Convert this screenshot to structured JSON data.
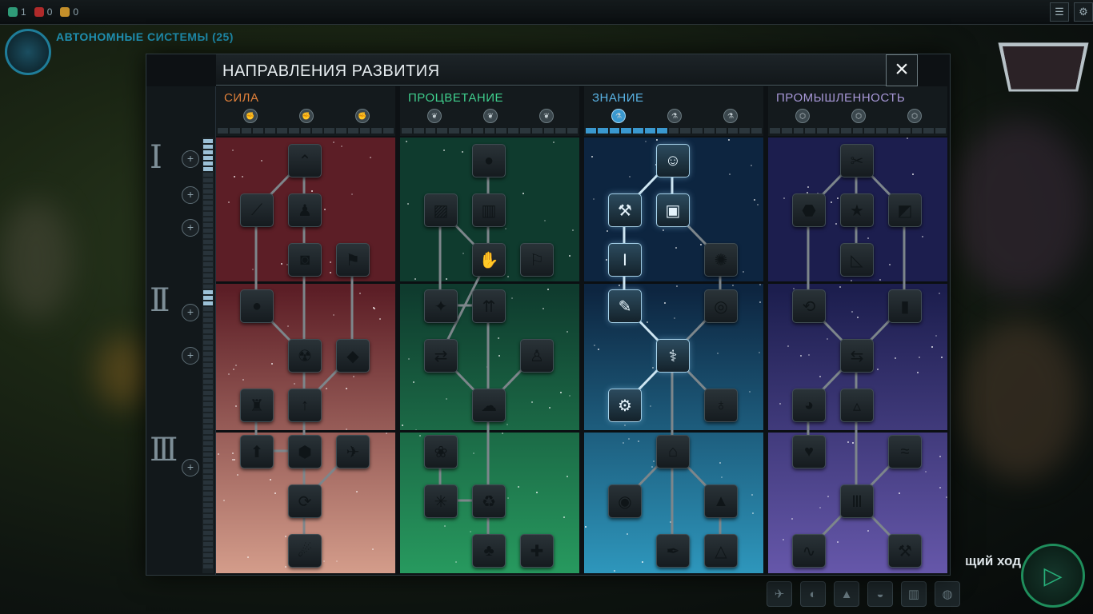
{
  "panel": {
    "title": "НАПРАВЛЕНИЯ РАЗВИТИЯ",
    "close_icon": "×"
  },
  "hud": {
    "faction_name": "АВТОНОМНЫЕ СИСТЕМЫ (25)",
    "end_turn_label": "щий ход"
  },
  "tiers": [
    {
      "roman": "I"
    },
    {
      "roman": "II"
    },
    {
      "roman": "III"
    }
  ],
  "columns": [
    {
      "id": "might",
      "name": "СИЛА",
      "color": "#e0803a",
      "bg_from": "#5c1e26",
      "bg_to": "#e6b09a",
      "level_icon": "fist-icon",
      "levels": [
        "✊",
        "✊",
        "✊"
      ],
      "progress_filled": 0,
      "nodes": [
        {
          "icon": "chevrons-icon",
          "glyph": "⌃",
          "lit": false
        },
        {
          "icon": "dagger-icon",
          "glyph": "⟋",
          "lit": false
        },
        {
          "icon": "soldier-icon",
          "glyph": "♟",
          "lit": false
        },
        {
          "icon": "camera-icon",
          "glyph": "◙",
          "lit": false
        },
        {
          "icon": "flag-icon",
          "glyph": "⚑",
          "lit": false
        },
        {
          "icon": "apple-core-icon",
          "glyph": "●",
          "lit": false
        },
        {
          "icon": "radiation-icon",
          "glyph": "☢",
          "lit": false
        },
        {
          "icon": "gem-icon",
          "glyph": "◆",
          "lit": false
        },
        {
          "icon": "tower-icon",
          "glyph": "♜",
          "lit": false
        },
        {
          "icon": "arrow-up-icon",
          "glyph": "↑",
          "lit": false
        },
        {
          "icon": "hex-arrow-icon",
          "glyph": "⬆",
          "lit": false
        },
        {
          "icon": "hex-nut-icon",
          "glyph": "⬢",
          "lit": false
        },
        {
          "icon": "missile-icon",
          "glyph": "✈",
          "lit": false
        },
        {
          "icon": "cycle-icon",
          "glyph": "⟳",
          "lit": false
        },
        {
          "icon": "comet-icon",
          "glyph": "☄",
          "lit": false
        }
      ]
    },
    {
      "id": "prosperity",
      "name": "ПРОЦВЕТАНИЕ",
      "color": "#3fcf8e",
      "bg_from": "#0f3b2e",
      "bg_to": "#2ba866",
      "level_icon": "leaf-icon",
      "levels": [
        "❦",
        "❦",
        "❦"
      ],
      "progress_filled": 0,
      "nodes": [
        {
          "icon": "apple-icon",
          "glyph": "●",
          "lit": false
        },
        {
          "icon": "map-icon",
          "glyph": "▨",
          "lit": false
        },
        {
          "icon": "bar-chart-icon",
          "glyph": "▥",
          "lit": false
        },
        {
          "icon": "hand-icon",
          "glyph": "✋",
          "lit": false
        },
        {
          "icon": "banner-icon",
          "glyph": "⚐",
          "lit": false
        },
        {
          "icon": "compass-icon",
          "glyph": "✦",
          "lit": false
        },
        {
          "icon": "fork-icon",
          "glyph": "⇈",
          "lit": false
        },
        {
          "icon": "exchange-icon",
          "glyph": "⇄",
          "lit": false
        },
        {
          "icon": "person-icon",
          "glyph": "♙",
          "lit": false
        },
        {
          "icon": "brain-icon",
          "glyph": "☁",
          "lit": false
        },
        {
          "icon": "lotus-icon",
          "glyph": "❀",
          "lit": false
        },
        {
          "icon": "burst-icon",
          "glyph": "✳",
          "lit": false
        },
        {
          "icon": "recycle-icon",
          "glyph": "♻",
          "lit": false
        },
        {
          "icon": "palm-icon",
          "glyph": "♣",
          "lit": false
        },
        {
          "icon": "medical-cross-icon",
          "glyph": "✚",
          "lit": false
        }
      ]
    },
    {
      "id": "knowledge",
      "name": "ЗНАНИЕ",
      "color": "#5ab4e6",
      "bg_from": "#0d2540",
      "bg_to": "#33a8cf",
      "level_icon": "flask-icon",
      "levels": [
        "⚗",
        "⚗",
        "⚗"
      ],
      "progress_filled": 7,
      "nodes": [
        {
          "icon": "scientist-icon",
          "glyph": "☺",
          "lit": true
        },
        {
          "icon": "pickaxe-icon",
          "glyph": "⚒",
          "lit": true
        },
        {
          "icon": "book-icon",
          "glyph": "▣",
          "lit": true
        },
        {
          "icon": "test-tube-icon",
          "glyph": "Ⅰ",
          "lit": true
        },
        {
          "icon": "lightbulb-icon",
          "glyph": "✺",
          "lit": false
        },
        {
          "icon": "feather-icon",
          "glyph": "✎",
          "lit": true
        },
        {
          "icon": "orbit-icon",
          "glyph": "◎",
          "lit": false
        },
        {
          "icon": "network-icon",
          "glyph": "⚕",
          "lit": true
        },
        {
          "icon": "bacteria-icon",
          "glyph": "⚙",
          "lit": true
        },
        {
          "icon": "planet-icon",
          "glyph": "♁",
          "lit": false
        },
        {
          "icon": "microscope-icon",
          "glyph": "⌂",
          "lit": false
        },
        {
          "icon": "eye-icon",
          "glyph": "◉",
          "lit": false
        },
        {
          "icon": "graduation-cap-icon",
          "glyph": "▲",
          "lit": false
        },
        {
          "icon": "pen-icon",
          "glyph": "✒",
          "lit": false
        },
        {
          "icon": "pyramid-icon",
          "glyph": "△",
          "lit": false
        }
      ]
    },
    {
      "id": "industry",
      "name": "ПРОМЫШЛЕННОСТЬ",
      "color": "#a898d8",
      "bg_from": "#1c1e4e",
      "bg_to": "#7160b8",
      "level_icon": "cube-icon",
      "levels": [
        "⬡",
        "⬡",
        "⬡"
      ],
      "progress_filled": 0,
      "nodes": [
        {
          "icon": "wrench-icon",
          "glyph": "✂",
          "lit": false
        },
        {
          "icon": "shield-hex-icon",
          "glyph": "⬣",
          "lit": false
        },
        {
          "icon": "star-badge-icon",
          "glyph": "★",
          "lit": false
        },
        {
          "icon": "resize-icon",
          "glyph": "◩",
          "lit": false
        },
        {
          "icon": "set-square-icon",
          "glyph": "◺",
          "lit": false
        },
        {
          "icon": "loop-icon",
          "glyph": "⟲",
          "lit": false
        },
        {
          "icon": "obelisk-icon",
          "glyph": "▮",
          "lit": false
        },
        {
          "icon": "shuffle-icon",
          "glyph": "⇆",
          "lit": false
        },
        {
          "icon": "apple-bite-icon",
          "glyph": "◕",
          "lit": false
        },
        {
          "icon": "triangle-nodes-icon",
          "glyph": "▵",
          "lit": false
        },
        {
          "icon": "heart-hand-icon",
          "glyph": "♥",
          "lit": false
        },
        {
          "icon": "wave-icon",
          "glyph": "≈",
          "lit": false
        },
        {
          "icon": "column-icon",
          "glyph": "Ⅲ",
          "lit": false
        },
        {
          "icon": "pulse-icon",
          "glyph": "∿",
          "lit": false
        },
        {
          "icon": "tool-off-icon",
          "glyph": "⚒",
          "lit": false
        }
      ]
    }
  ]
}
